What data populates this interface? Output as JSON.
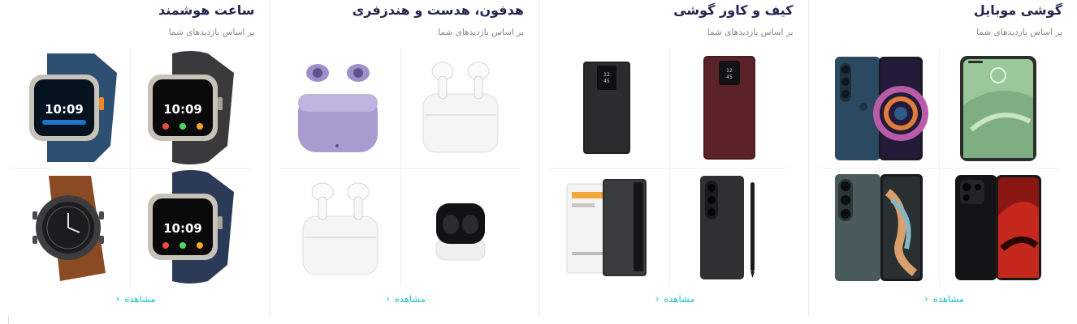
{
  "columns": [
    {
      "title": "گوشی موبایل",
      "subtitle": "بر اساس بازدیدهای شما",
      "more_label": "مشاهده",
      "products": [
        "phone-green-icon",
        "phone-blue-icon",
        "phone-black-icon",
        "foldable-phone-icon"
      ]
    },
    {
      "title": "کیف و کاور گوشی",
      "subtitle": "بر اساس بازدیدهای شما",
      "more_label": "مشاهده",
      "products": [
        "flip-case-burgundy-icon",
        "flip-case-black-icon",
        "fold-case-with-pen-icon",
        "flip-case-boxed-icon"
      ]
    },
    {
      "title": "هدفون، هدست و هندزفری",
      "subtitle": "بر اساس بازدیدهای شما",
      "more_label": "مشاهده",
      "products": [
        "earbuds-white-icon",
        "earbuds-purple-icon",
        "earbuds-black-icon",
        "earbuds-white-case-icon"
      ]
    },
    {
      "title": "ساعت هوشمند",
      "subtitle": "بر اساس بازدیدهای شما",
      "more_label": "مشاهده",
      "products": [
        "watch-loop-band-icon",
        "watch-ocean-band-icon",
        "watch-alpine-band-icon",
        "watch-leather-band-icon"
      ]
    }
  ]
}
